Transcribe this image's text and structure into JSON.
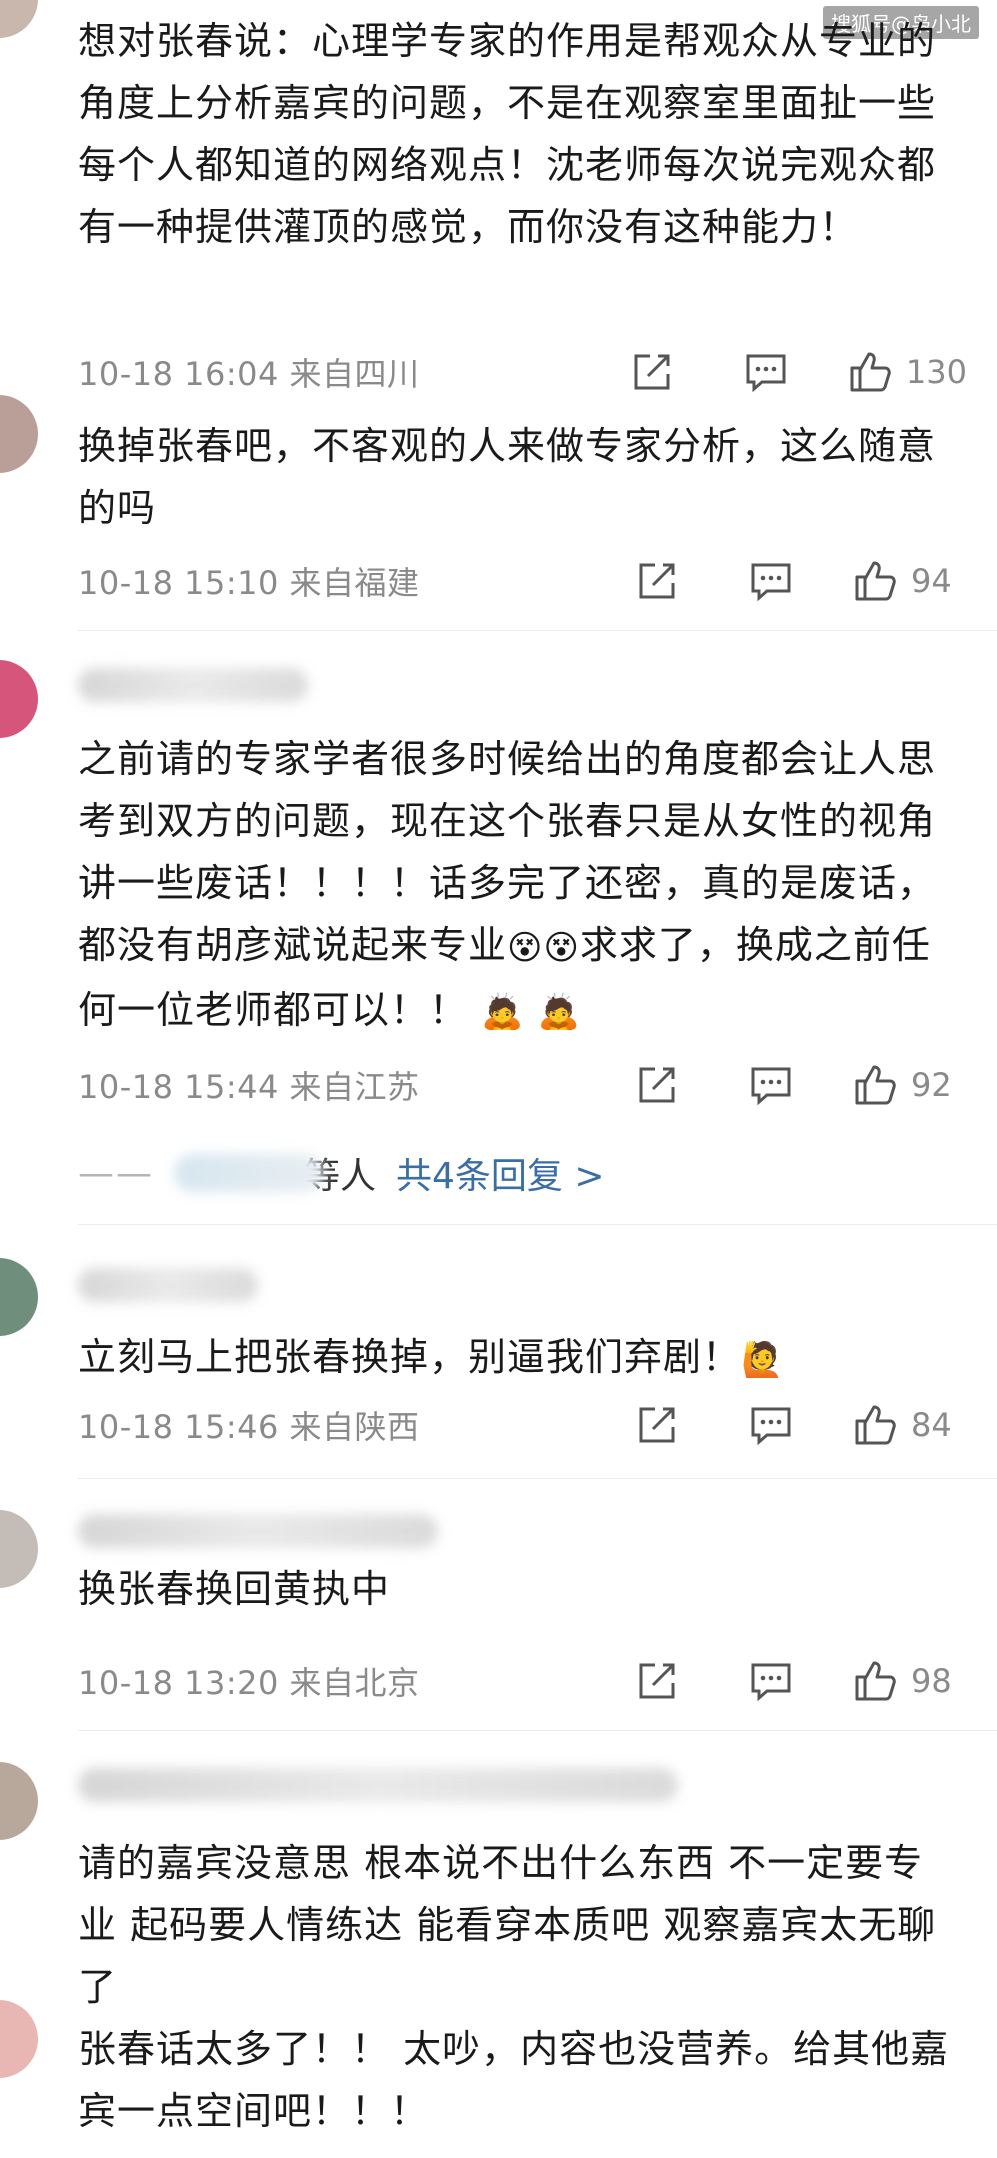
{
  "watermark": "搜狐号@枭小北",
  "comments": [
    {
      "text": "想对张春说：心理学专家的作用是帮观众从专业的角度上分析嘉宾的问题，不是在观察室里面扯一些每个人都知道的网络观点！沈老师每次说完观众都有一种提供灌顶的感觉，而你没有这种能力！",
      "time": "10-18 16:04",
      "location": "来自四川",
      "likes": "130"
    },
    {
      "text": "换掉张春吧，不客观的人来做专家分析，这么随意的吗",
      "time": "10-18 15:10",
      "location": "来自福建",
      "likes": "94"
    },
    {
      "text_a": "之前请的专家学者很多时候给出的角度都会让人思考到双方的问题，现在这个张春只是从女性的视角讲一些废话！！！！话多完了还密，真的是废话，都没有胡彦斌说起来专业",
      "text_b": "求求了，换成之前任何一位老师都可以！！",
      "emoji_a": "😵",
      "emoji_b": "🙇",
      "time": "10-18 15:44",
      "location": "来自江苏",
      "likes": "92",
      "replies_who": "等人",
      "replies_link": "共4条回复 >",
      "replies_dash": "——"
    },
    {
      "text": "立刻马上把张春换掉，别逼我们弃剧！",
      "emoji": "🙋",
      "time": "10-18 15:46",
      "location": "来自陕西",
      "likes": "84"
    },
    {
      "text": "换张春换回黄执中",
      "time": "10-18 13:20",
      "location": "来自北京",
      "likes": "98"
    },
    {
      "text": "请的嘉宾没意思 根本说不出什么东西 不一定要专业 起码要人情练达 能看穿本质吧 观察嘉宾太无聊了"
    },
    {
      "text": "张春话太多了！！ 太吵，内容也没营养。给其他嘉宾一点空间吧！！！"
    }
  ],
  "icons": {
    "share": "share-icon",
    "comment": "comment-icon",
    "like": "thumbs-up-icon"
  },
  "colors": {
    "link": "#3a6ea5",
    "meta": "#8a8a8a",
    "text": "#1a1a1a"
  }
}
